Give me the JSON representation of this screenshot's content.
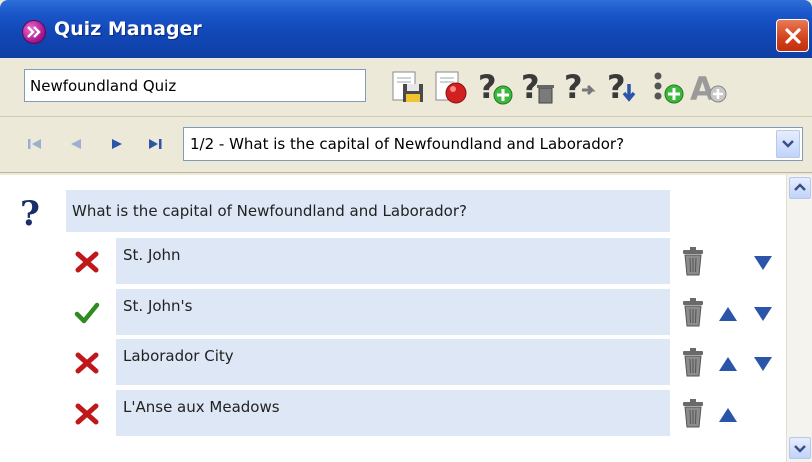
{
  "window": {
    "title": "Quiz Manager"
  },
  "toolbar": {
    "quiz_name": "Newfoundland Quiz",
    "icons": [
      "save-icon",
      "record-icon",
      "add-question-icon",
      "delete-question-icon",
      "move-question-icon",
      "next-question-icon",
      "add-answer-icon",
      "spellcheck-icon"
    ]
  },
  "navigation": {
    "selected_question": "1/2 - What is the capital of Newfoundland and Laborador?"
  },
  "question": {
    "text": "What is the capital of Newfoundland and Laborador?"
  },
  "answers": [
    {
      "text": "St. John",
      "correct": false,
      "show_up": false,
      "show_down": true
    },
    {
      "text": "St. John's",
      "correct": true,
      "show_up": true,
      "show_down": true
    },
    {
      "text": "Laborador City",
      "correct": false,
      "show_up": true,
      "show_down": true
    },
    {
      "text": "L'Anse aux Meadows",
      "correct": false,
      "show_up": true,
      "show_down": false
    }
  ],
  "colors": {
    "titlebar": "#1148b8",
    "field_bg": "#dde7f5",
    "correct": "#2e8b1e",
    "incorrect": "#c0181a",
    "arrow": "#2a55a8"
  }
}
